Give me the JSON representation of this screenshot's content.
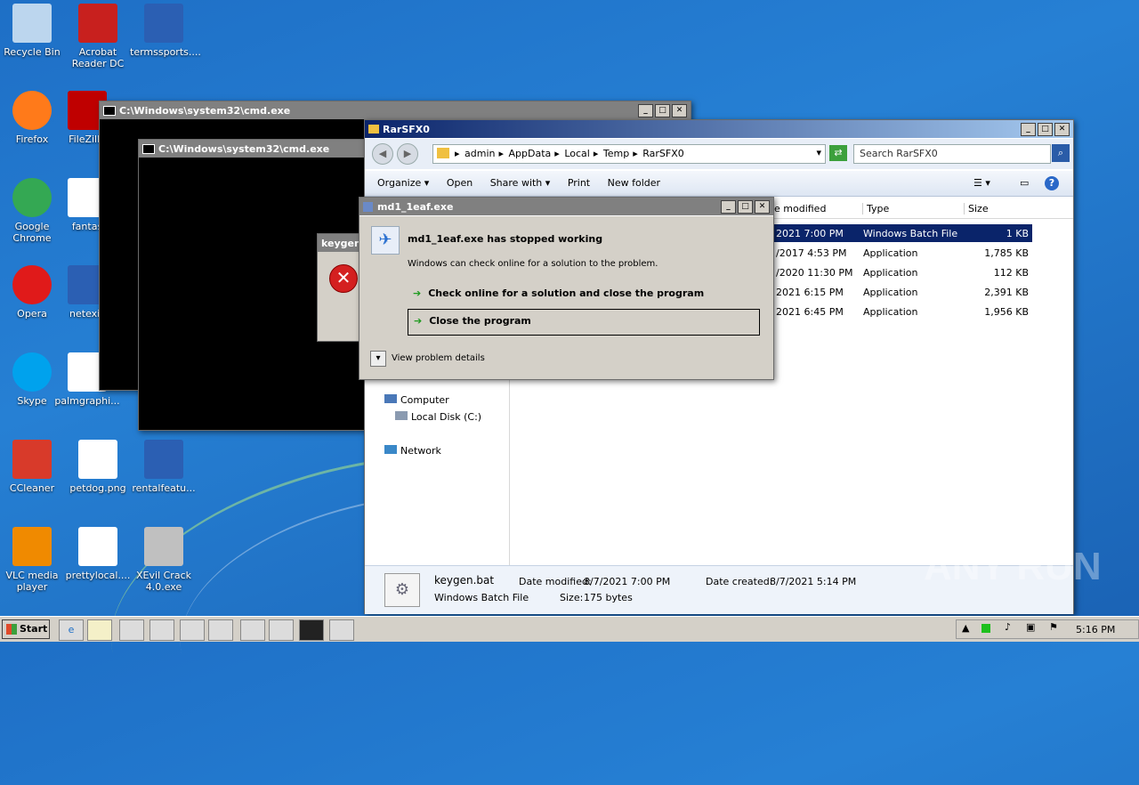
{
  "desktop": {
    "icons": [
      {
        "label": "Recycle Bin",
        "icon": "recycle-bin-icon",
        "color": "#bcd6ee"
      },
      {
        "label": "Acrobat Reader DC",
        "icon": "acrobat-icon",
        "color": "#c8201e"
      },
      {
        "label": "termssports....",
        "icon": "word-doc-icon",
        "color": "#2b5fb3"
      },
      {
        "label": "Firefox",
        "icon": "firefox-icon",
        "color": "#ff7a1a"
      },
      {
        "label": "FileZilla",
        "icon": "filezilla-icon",
        "color": "#bf0000"
      },
      {
        "label": "Google Chrome",
        "icon": "chrome-icon",
        "color": "#34a853"
      },
      {
        "label": "fantas",
        "icon": "file-icon",
        "color": "#ffffff"
      },
      {
        "label": "Opera",
        "icon": "opera-icon",
        "color": "#e01a1a"
      },
      {
        "label": "netexis",
        "icon": "word-doc-icon",
        "color": "#2b5fb3"
      },
      {
        "label": "Skype",
        "icon": "skype-icon",
        "color": "#00a2ed"
      },
      {
        "label": "palmgraphi...",
        "icon": "file-icon",
        "color": "#ffffff"
      },
      {
        "label": "CCleaner",
        "icon": "ccleaner-icon",
        "color": "#d83a2a"
      },
      {
        "label": "petdog.png",
        "icon": "image-icon",
        "color": "#ffffff"
      },
      {
        "label": "rentalfeatu...",
        "icon": "word-doc-icon",
        "color": "#2b5fb3"
      },
      {
        "label": "VLC media player",
        "icon": "vlc-icon",
        "color": "#f08a00"
      },
      {
        "label": "prettylocal....",
        "icon": "file-icon",
        "color": "#ffffff"
      },
      {
        "label": "XEvil Crack 4.0.exe",
        "icon": "key-icon",
        "color": "#c0c0c0"
      }
    ]
  },
  "cmd1": {
    "title": "C:\\Windows\\system32\\cmd.exe"
  },
  "cmd2": {
    "title": "C:\\Windows\\system32\\cmd.exe"
  },
  "keygen_error": {
    "title": "keygen"
  },
  "explorer": {
    "title": "RarSFX0",
    "breadcrumb": [
      "admin",
      "AppData",
      "Local",
      "Temp",
      "RarSFX0"
    ],
    "search_placeholder": "Search RarSFX0",
    "toolbar": {
      "organize": "Organize",
      "open": "Open",
      "share_with": "Share with",
      "print": "Print",
      "new_folder": "New folder"
    },
    "columns": {
      "date_modified": "e modified",
      "type": "Type",
      "size": "Size"
    },
    "rows": [
      {
        "date": "2021 7:00 PM",
        "type": "Windows Batch File",
        "size": "1 KB"
      },
      {
        "date": "/2017 4:53 PM",
        "type": "Application",
        "size": "1,785 KB"
      },
      {
        "date": "/2020 11:30 PM",
        "type": "Application",
        "size": "112 KB"
      },
      {
        "date": "2021 6:15 PM",
        "type": "Application",
        "size": "2,391 KB"
      },
      {
        "date": "2021 6:45 PM",
        "type": "Application",
        "size": "1,956 KB"
      }
    ],
    "nav": {
      "computer": "Computer",
      "local_disk": "Local Disk (C:)",
      "network": "Network"
    },
    "details": {
      "filename": "keygen.bat",
      "filetype": "Windows Batch File",
      "date_modified_label": "Date modified:",
      "date_modified": "8/7/2021 7:00 PM",
      "size_label": "Size:",
      "size": "175 bytes",
      "date_created_label": "Date created:",
      "date_created": "8/7/2021 5:14 PM"
    }
  },
  "dialog": {
    "title": "md1_1eaf.exe",
    "heading": "md1_1eaf.exe has stopped working",
    "subtext": "Windows can check online for a solution to the problem.",
    "option1": "Check online for a solution and close the program",
    "option2": "Close the program",
    "details": "View problem details"
  },
  "taskbar": {
    "start": "Start",
    "time": "5:16 PM"
  },
  "watermark": "ANY RUN",
  "colors": {
    "titlebar_active": "#0a246a",
    "titlebar_inactive": "#808080",
    "selection": "#0a246a"
  }
}
